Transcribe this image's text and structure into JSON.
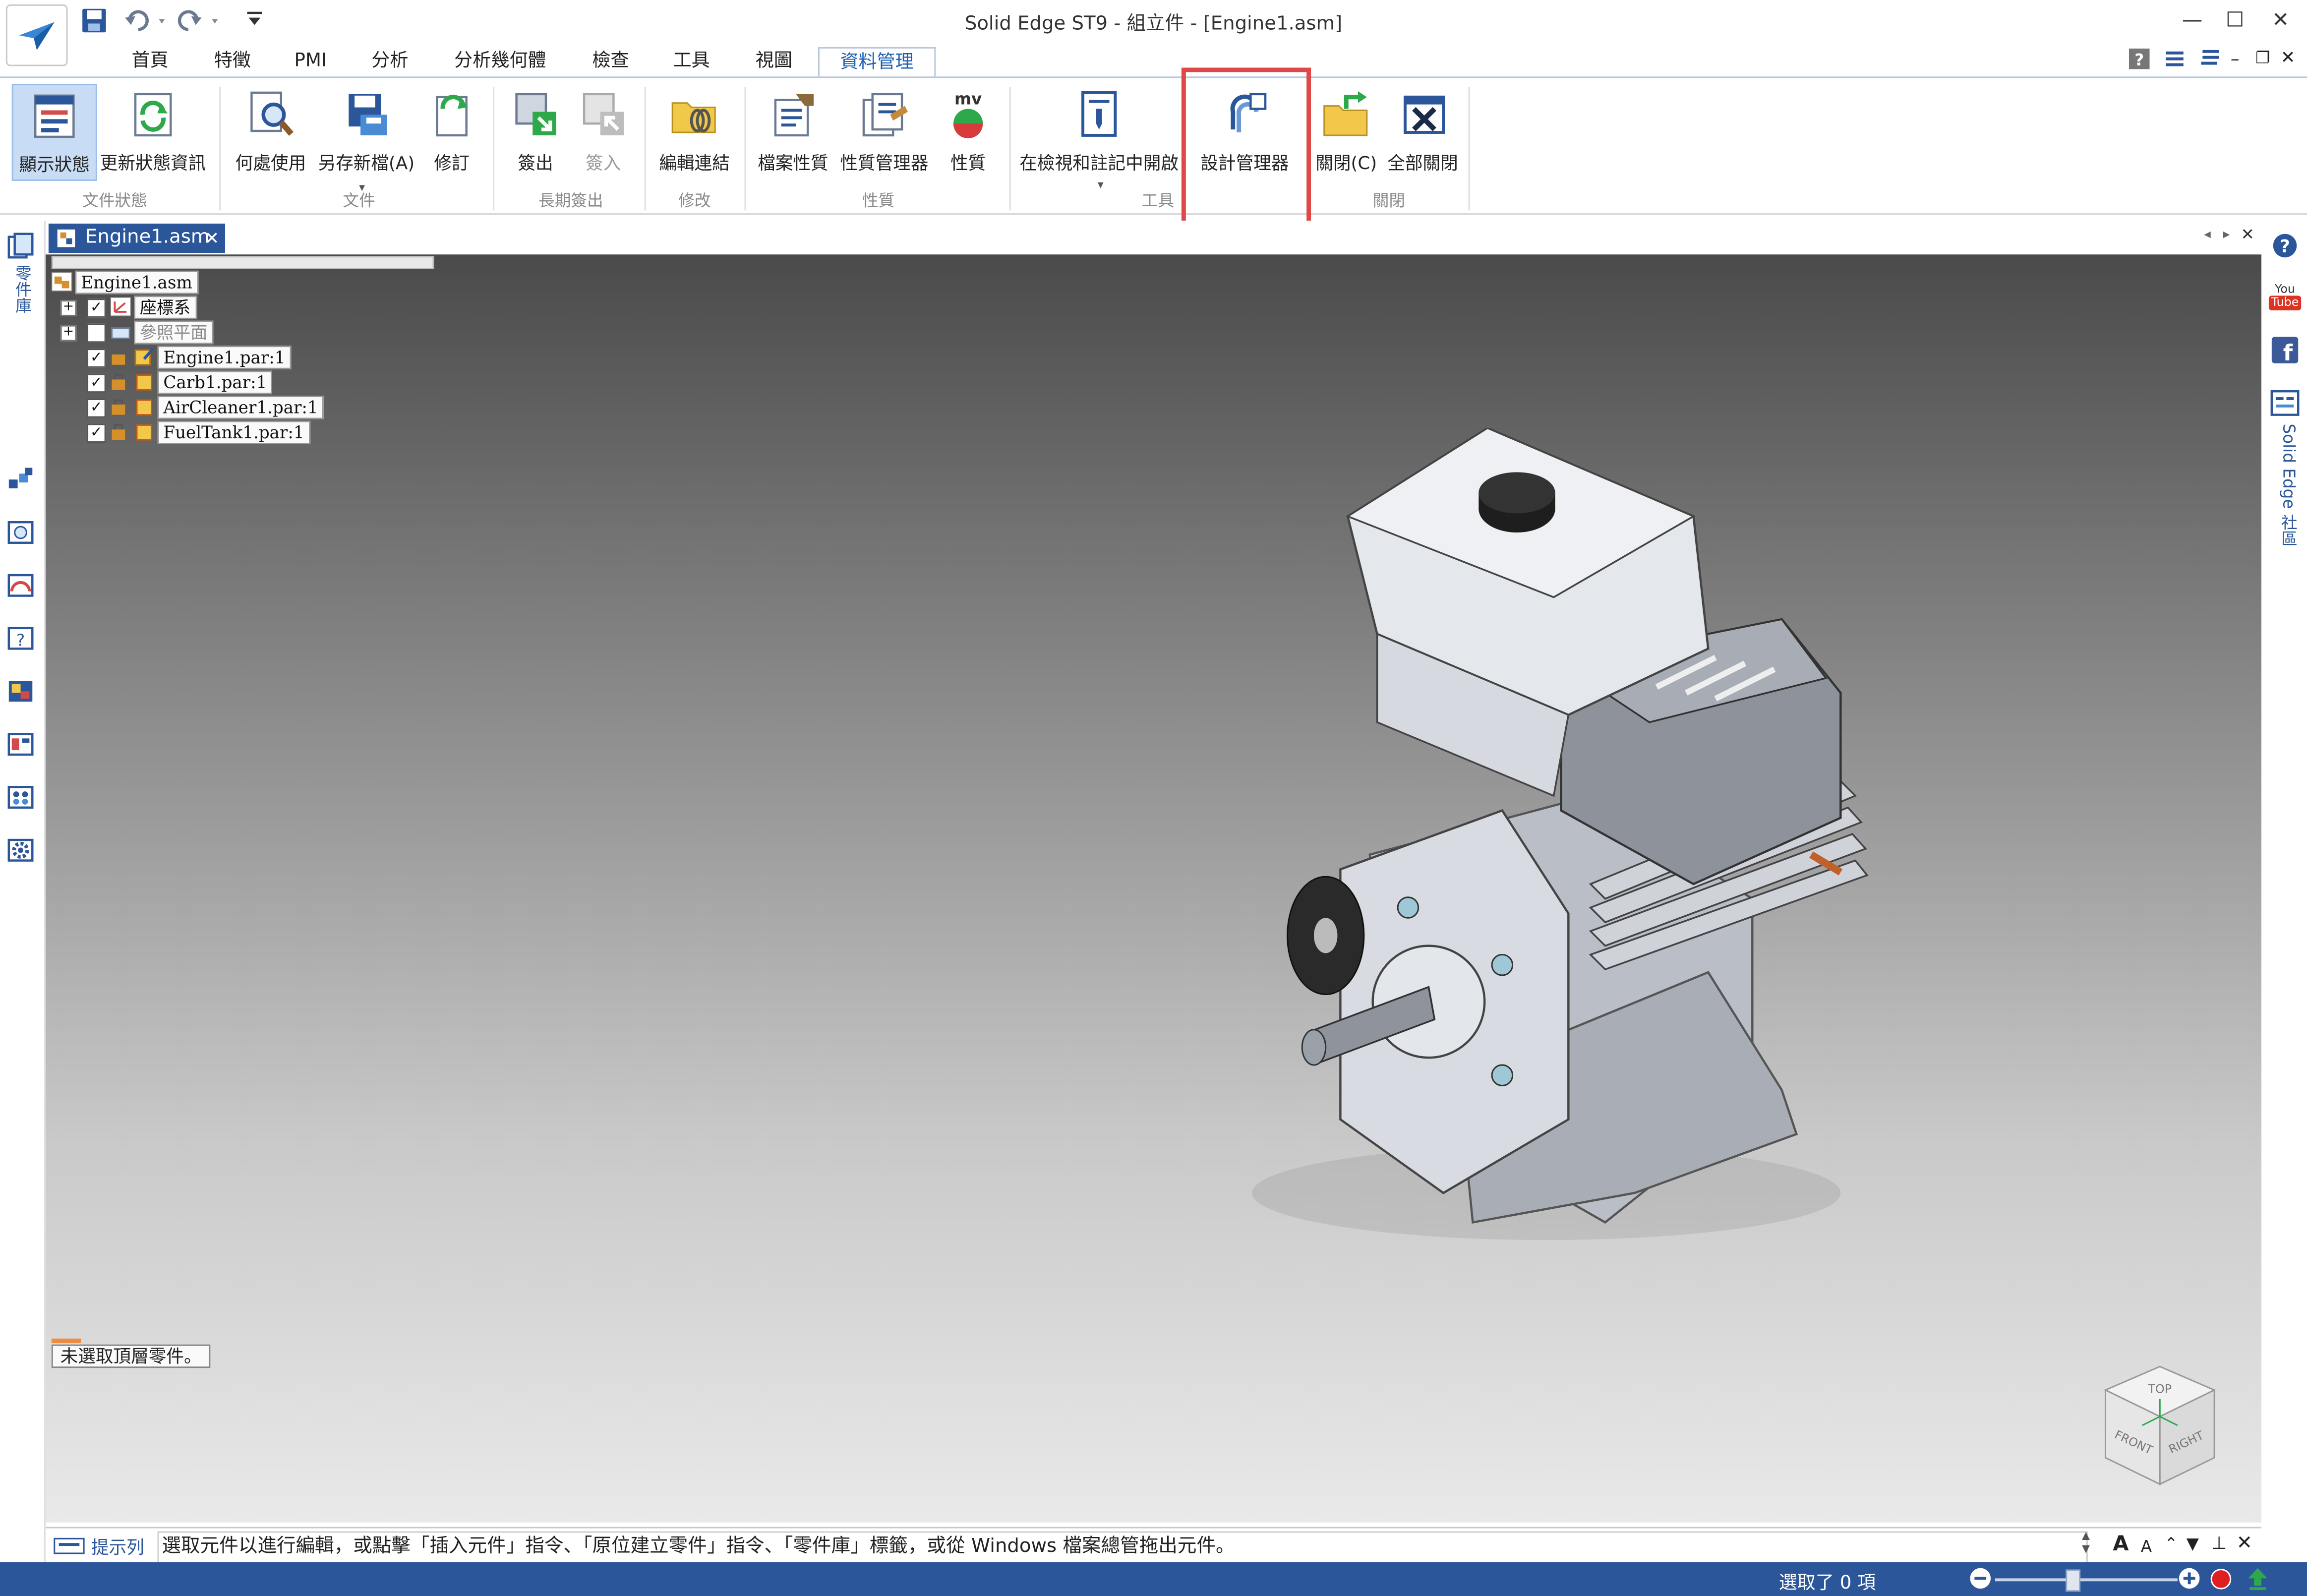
{
  "window": {
    "title": "Solid Edge ST9 - 組立件 - [Engine1.asm]",
    "minimize": "—",
    "maximize": "☐",
    "close": "✕"
  },
  "ribbon": {
    "tabs": [
      "首頁",
      "特徵",
      "PMI",
      "分析",
      "分析幾何體",
      "檢查",
      "工具",
      "視圖",
      "資料管理"
    ],
    "active_tab": "資料管理",
    "buttons": [
      {
        "label": "顯示狀態",
        "icon": "display-status-icon"
      },
      {
        "label": "更新狀態資訊",
        "icon": "refresh-status-icon"
      },
      {
        "label": "何處使用",
        "icon": "where-used-icon"
      },
      {
        "label": "另存新檔(A)",
        "icon": "save-as-icon"
      },
      {
        "label": "修訂",
        "icon": "revise-icon"
      },
      {
        "label": "簽出",
        "icon": "check-out-icon"
      },
      {
        "label": "簽入",
        "icon": "check-in-icon"
      },
      {
        "label": "編輯連結",
        "icon": "edit-links-icon"
      },
      {
        "label": "檔案性質",
        "icon": "file-properties-icon"
      },
      {
        "label": "性質管理器",
        "icon": "property-manager-icon"
      },
      {
        "label": "性質",
        "icon": "mv-properties-icon",
        "badge": "mv"
      },
      {
        "label": "在檢視和註記中開啟",
        "icon": "view-markup-icon"
      },
      {
        "label": "設計管理器",
        "icon": "design-manager-icon"
      },
      {
        "label": "關閉(C)",
        "icon": "close-folder-icon"
      },
      {
        "label": "全部關閉",
        "icon": "close-all-icon"
      }
    ],
    "groups": [
      "文件狀態",
      "文件",
      "長期簽出",
      "修改",
      "性質",
      "工具",
      "關閉"
    ]
  },
  "document": {
    "tab_label": "Engine1.asm",
    "tab_close": "✕"
  },
  "tree": {
    "root": "Engine1.asm",
    "items": [
      {
        "label": "座標系",
        "checked": true,
        "expandable": true
      },
      {
        "label": "參照平面",
        "checked": false,
        "expandable": true
      },
      {
        "label": "Engine1.par:1",
        "checked": true,
        "expandable": false
      },
      {
        "label": "Carb1.par:1",
        "checked": true,
        "expandable": false
      },
      {
        "label": "AirCleaner1.par:1",
        "checked": true,
        "expandable": false
      },
      {
        "label": "FuelTank1.par:1",
        "checked": true,
        "expandable": false
      }
    ]
  },
  "left_toolbar": {
    "vertical_label": "零件庫"
  },
  "right_toolbar": {
    "community_label": "Solid Edge 社區",
    "youtube_top": "You",
    "youtube_bottom": "Tube"
  },
  "viewport": {
    "status_message": "未選取頂層零件。",
    "view_cube": {
      "top": "TOP",
      "front": "FRONT",
      "right": "RIGHT"
    }
  },
  "prompt": {
    "label": "提示列",
    "text": "選取元件以進行編輯，或點擊「插入元件」指令、「原位建立零件」指令、「零件庫」標籤，或從 Windows 檔案總管拖出元件。"
  },
  "status_bar": {
    "selection": "選取了 0 項"
  }
}
